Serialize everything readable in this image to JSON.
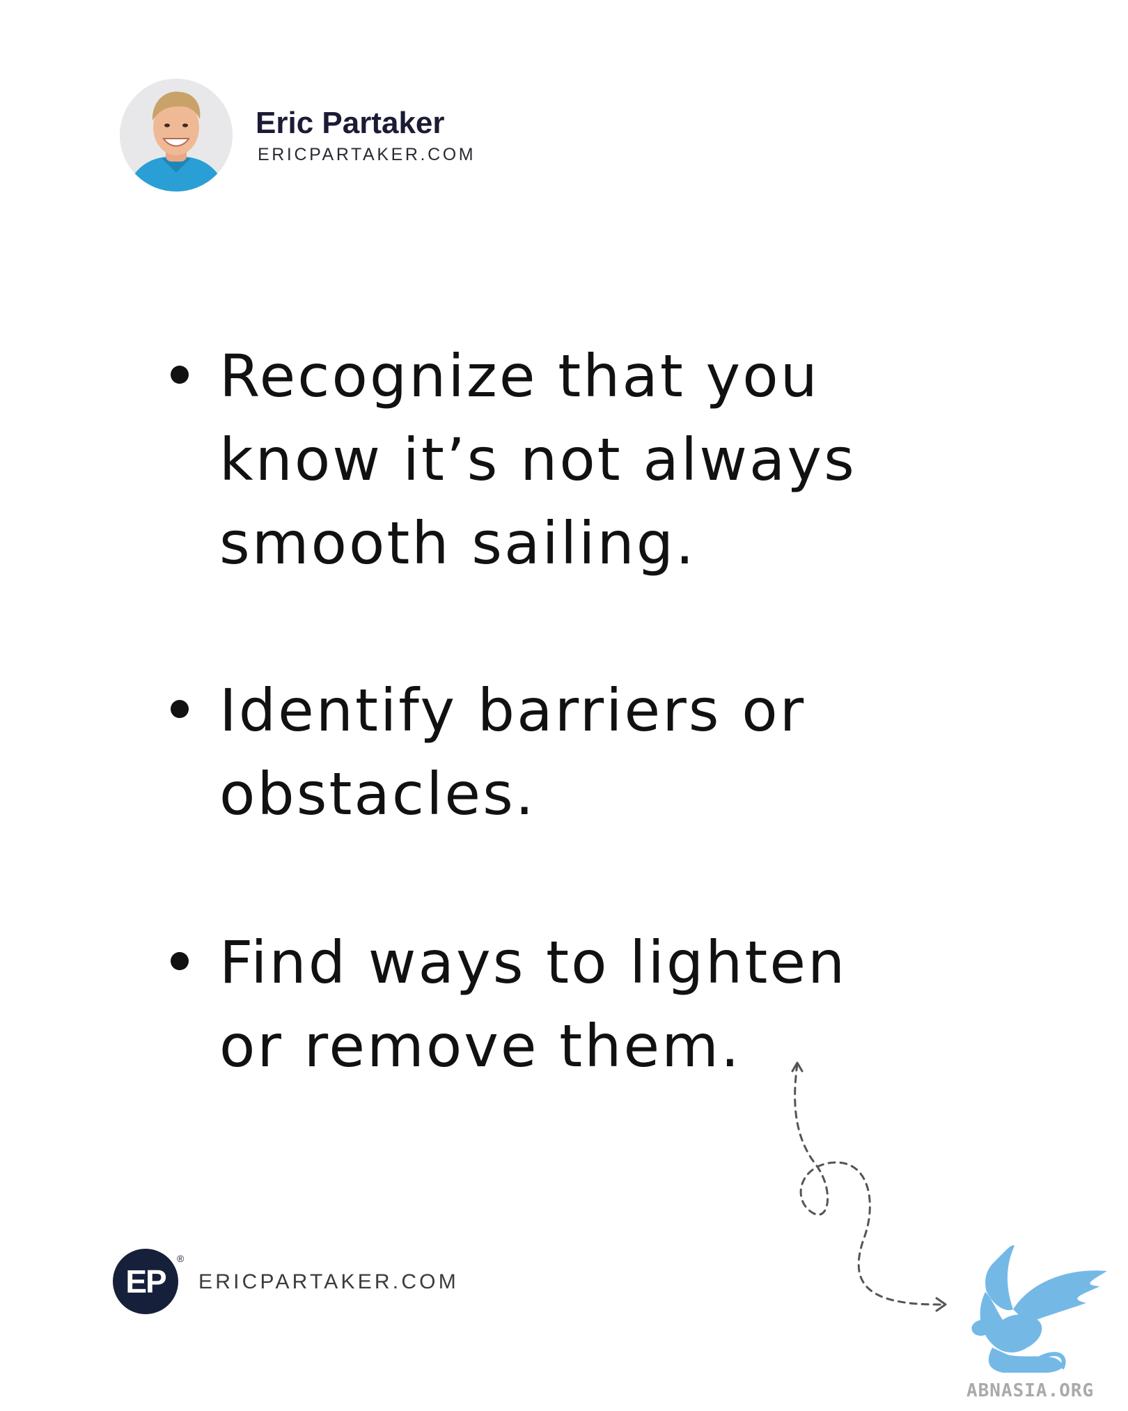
{
  "header": {
    "name": "Eric Partaker",
    "website": "ERICPARTAKER.COM"
  },
  "bullets": [
    {
      "text": "Recognize that you know it’s not always smooth sailing."
    },
    {
      "text": "Identify barriers or obstacles."
    },
    {
      "text": "Find ways to lighten or remove them."
    }
  ],
  "footer": {
    "logo_text": "EP",
    "registered_mark": "®",
    "website": "ERICPARTAKER.COM"
  },
  "watermark": {
    "text": "ABNASIA.ORG"
  },
  "colors": {
    "background": "#ffffff",
    "text": "#111111",
    "name": "#1b1b36",
    "logo_circle": "#16203a",
    "avatar_shirt": "#2a9fd6",
    "watermark_griffin": "#74b9e6"
  },
  "icons": {
    "avatar": "author-portrait",
    "logo": "ep-logo",
    "decoration": "dotted-arrow-icon",
    "watermark": "griffin-logo"
  }
}
